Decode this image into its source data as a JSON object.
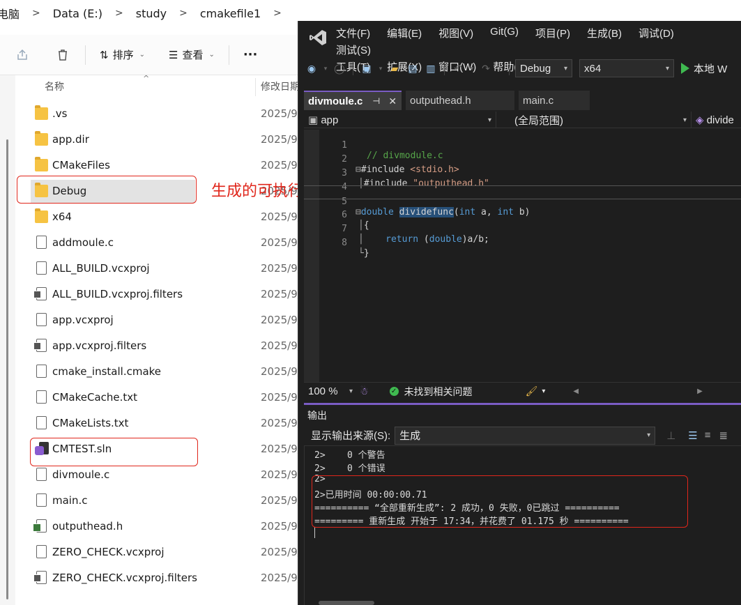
{
  "explorer": {
    "breadcrumb": [
      "电脑",
      "Data (E:)",
      "study",
      "cmakefile1"
    ],
    "toolbar": {
      "sort_label": "排序",
      "view_label": "查看",
      "more_label": "···"
    },
    "columns": {
      "name": "名称",
      "date": "修改日期"
    },
    "files": [
      {
        "name": ".vs",
        "date": "2025/9/",
        "type": "folder"
      },
      {
        "name": "app.dir",
        "date": "2025/9/",
        "type": "folder"
      },
      {
        "name": "CMakeFiles",
        "date": "2025/9/",
        "type": "folder"
      },
      {
        "name": "Debug",
        "date": "2025/9/",
        "type": "folder",
        "selected": true
      },
      {
        "name": "x64",
        "date": "2025/9/",
        "type": "folder"
      },
      {
        "name": "addmoule.c",
        "date": "2025/9/",
        "type": "file"
      },
      {
        "name": "ALL_BUILD.vcxproj",
        "date": "2025/9/",
        "type": "file"
      },
      {
        "name": "ALL_BUILD.vcxproj.filters",
        "date": "2025/9/",
        "type": "project"
      },
      {
        "name": "app.vcxproj",
        "date": "2025/9/",
        "type": "file"
      },
      {
        "name": "app.vcxproj.filters",
        "date": "2025/9/",
        "type": "project"
      },
      {
        "name": "cmake_install.cmake",
        "date": "2025/9/",
        "type": "file"
      },
      {
        "name": "CMakeCache.txt",
        "date": "2025/9/",
        "type": "file"
      },
      {
        "name": "CMakeLists.txt",
        "date": "2025/9/",
        "type": "file"
      },
      {
        "name": "CMTEST.sln",
        "date": "2025/9/",
        "type": "solution"
      },
      {
        "name": "divmoule.c",
        "date": "2025/9/",
        "type": "file"
      },
      {
        "name": "main.c",
        "date": "2025/9/",
        "type": "file"
      },
      {
        "name": "outputhead.h",
        "date": "2025/9/",
        "type": "header"
      },
      {
        "name": "ZERO_CHECK.vcxproj",
        "date": "2025/9/",
        "type": "file"
      },
      {
        "name": "ZERO_CHECK.vcxproj.filters",
        "date": "2025/9/",
        "type": "project"
      }
    ]
  },
  "annotation": {
    "text": "生成的可执行文件放在这个目录下",
    "color": "#e0261b"
  },
  "vs": {
    "menu": [
      "文件(F)",
      "编辑(E)",
      "视图(V)",
      "Git(G)",
      "项目(P)",
      "生成(B)",
      "调试(D)",
      "测试(S)",
      "工具(T)",
      "扩展(X)",
      "窗口(W)",
      "帮助(H)"
    ],
    "config": "Debug",
    "platform": "x64",
    "run_label": "本地 W",
    "tabs": [
      {
        "label": "divmoule.c",
        "active": true
      },
      {
        "label": "outputhead.h",
        "active": false
      },
      {
        "label": "main.c",
        "active": false
      }
    ],
    "nav": {
      "project": "app",
      "scope": "(全局范围)",
      "member": "divide"
    },
    "code_lines": [
      {
        "num": "1"
      },
      {
        "num": "2"
      },
      {
        "num": "3"
      },
      {
        "num": "4"
      },
      {
        "num": "5"
      },
      {
        "num": "6"
      },
      {
        "num": "7"
      },
      {
        "num": "8"
      }
    ],
    "status": {
      "zoom": "100 %",
      "issues": "未找到相关问题"
    },
    "output": {
      "title": "输出",
      "source_label": "显示输出来源(S):",
      "source_value": "生成",
      "lines": [
        "2>    0 个警告",
        "2>    0 个错误",
        "2>",
        "2>已用时间 00:00:00.71",
        "========== “全部重新生成”: 2 成功，0 失败，0已跳过 ==========",
        "========= 重新生成 开始于 17:34，并花费了 01.175 秒 =========="
      ]
    },
    "colors": {
      "accent": "#7a5cc4",
      "keyword": "#569cd6",
      "comment": "#57a64a",
      "string": "#d69d85"
    }
  }
}
